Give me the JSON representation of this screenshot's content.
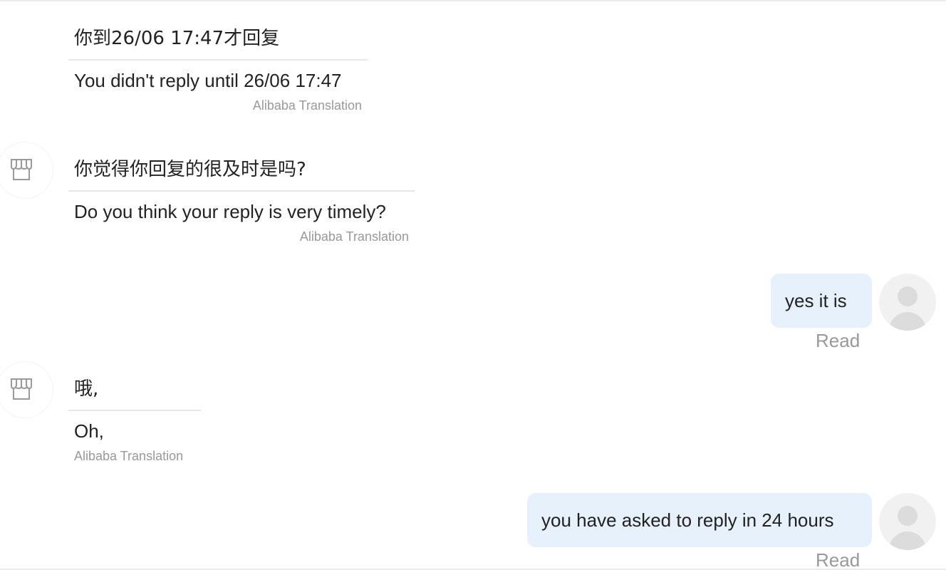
{
  "messages": [
    {
      "direction": "incoming",
      "original": "你到26/06 17:47才回复",
      "translation": "You didn't reply until 26/06 17:47",
      "credit": "Alibaba Translation"
    },
    {
      "direction": "incoming",
      "avatar": "shop-icon",
      "original": "你觉得你回复的很及时是吗?",
      "translation": "Do you think your reply is very timely?",
      "credit": "Alibaba Translation"
    },
    {
      "direction": "outgoing",
      "avatar": "user-avatar-icon",
      "text": "yes it is",
      "status": "Read"
    },
    {
      "direction": "incoming",
      "avatar": "shop-icon",
      "original": "哦,",
      "translation": "Oh,",
      "credit": "Alibaba Translation"
    },
    {
      "direction": "outgoing",
      "avatar": "user-avatar-icon",
      "text": "you have asked to reply in 24 hours",
      "status": "Read"
    }
  ],
  "colors": {
    "outgoing_bubble": "#e6f1fc",
    "muted_text": "#999999",
    "divider": "#e6e6e6"
  }
}
